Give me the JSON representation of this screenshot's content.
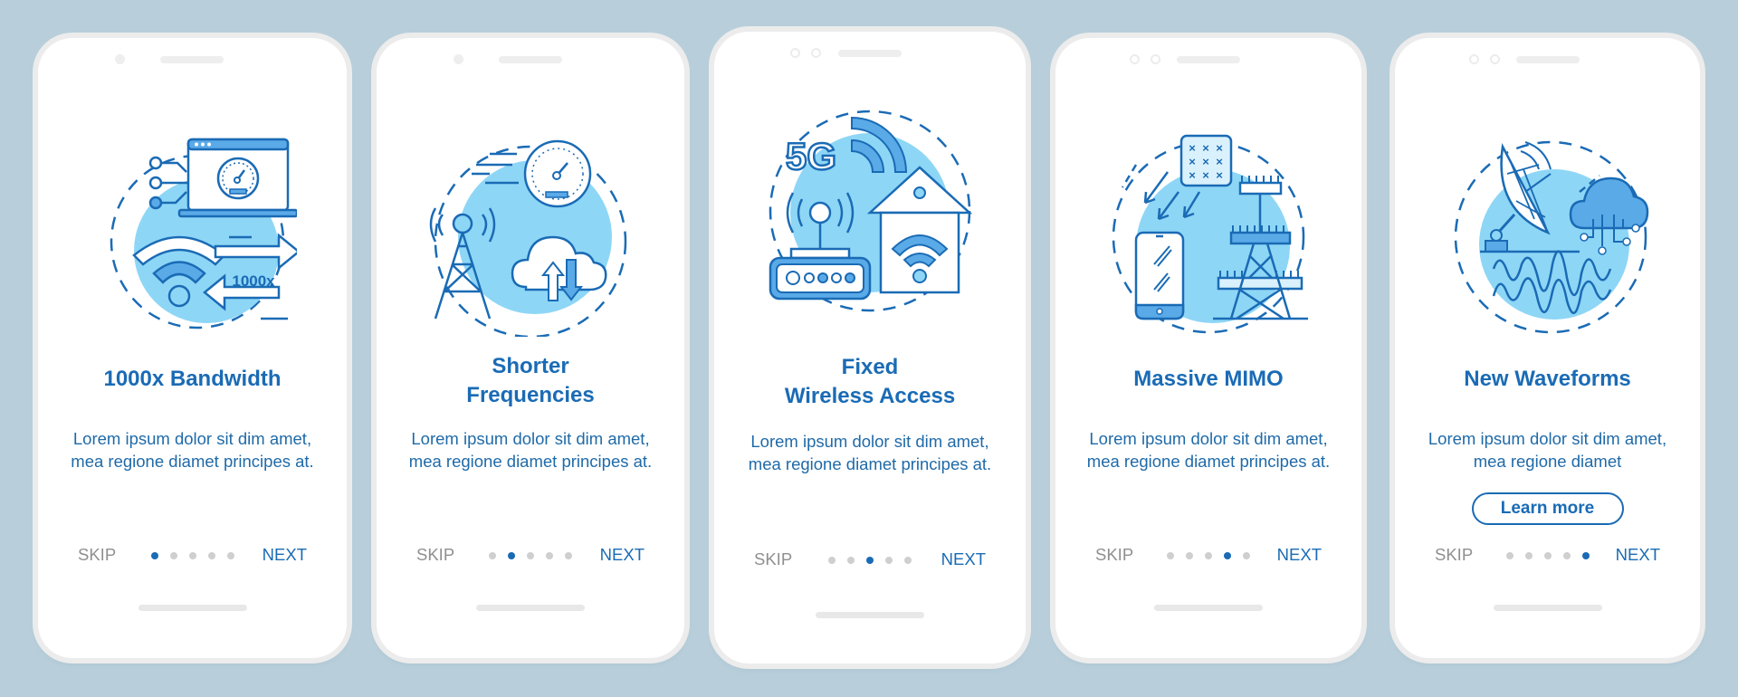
{
  "colors": {
    "background": "#b8cfdb",
    "accent": "#1a6bb5",
    "illustration_light": "#8ed6f6",
    "illustration_mid": "#5aaae8",
    "dot_inactive": "#cfcfcf",
    "skip_gray": "#8f8f8f"
  },
  "screens": [
    {
      "illustration": "bandwidth-laptop-speedometer-wifi-icon",
      "illustration_text": "1000x",
      "title_line1": "1000x Bandwidth",
      "title_line2": "",
      "description": "Lorem ipsum dolor sit dim amet, mea regione diamet principes at.",
      "skip_label": "SKIP",
      "next_label": "NEXT",
      "page_count": 5,
      "active_page": 1
    },
    {
      "illustration": "cell-tower-speedometer-cloud-icon",
      "title_line1": "Shorter",
      "title_line2": "Frequencies",
      "description": "Lorem ipsum dolor sit dim amet, mea regione diamet principes at.",
      "skip_label": "SKIP",
      "next_label": "NEXT",
      "page_count": 5,
      "active_page": 2
    },
    {
      "illustration": "5g-router-house-wifi-icon",
      "illustration_text": "5G",
      "title_line1": "Fixed",
      "title_line2": "Wireless Access",
      "description": "Lorem ipsum dolor sit dim amet, mea regione diamet principes at.",
      "skip_label": "SKIP",
      "next_label": "NEXT",
      "page_count": 5,
      "active_page": 3
    },
    {
      "illustration": "antenna-array-phone-tower-icon",
      "title_line1": "Massive MIMO",
      "title_line2": "",
      "description": "Lorem ipsum dolor sit dim amet, mea regione diamet principes at.",
      "skip_label": "SKIP",
      "next_label": "NEXT",
      "page_count": 5,
      "active_page": 4
    },
    {
      "illustration": "satellite-dish-cloud-waveform-icon",
      "title_line1": "New Waveforms",
      "title_line2": "",
      "description": "Lorem ipsum dolor sit dim amet, mea regione diamet",
      "button_label": "Learn more",
      "skip_label": "SKIP",
      "next_label": "NEXT",
      "page_count": 5,
      "active_page": 5
    }
  ]
}
